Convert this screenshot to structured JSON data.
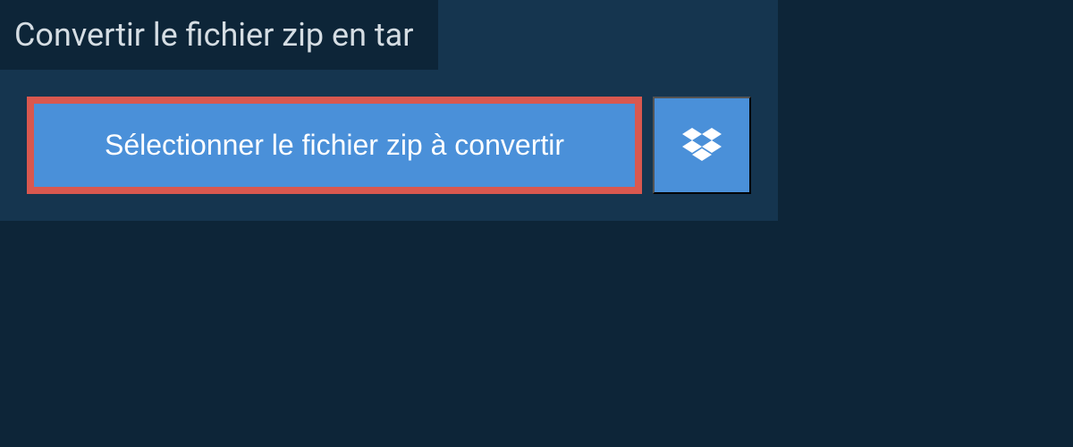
{
  "header": {
    "title": "Convertir le fichier zip en tar"
  },
  "actions": {
    "select_file_label": "Sélectionner le fichier zip à convertir"
  }
}
